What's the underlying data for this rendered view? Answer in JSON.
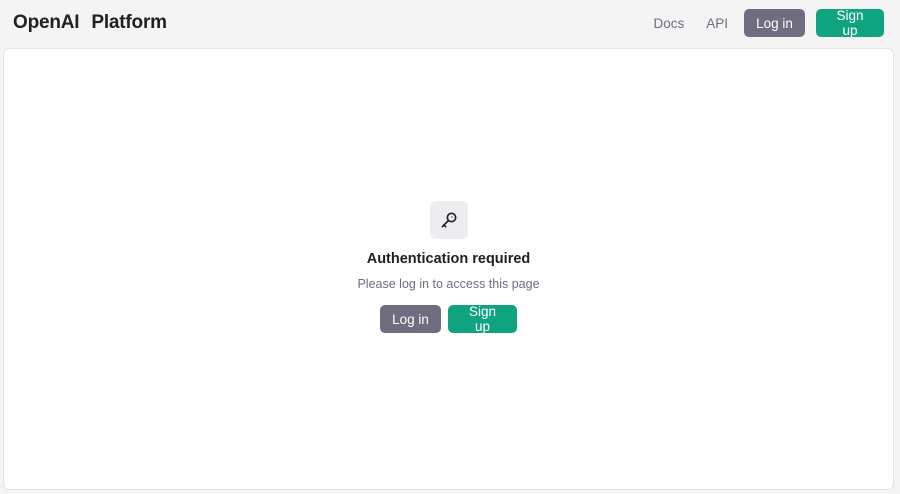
{
  "header": {
    "brand_left": "OpenAI",
    "brand_right": "Platform",
    "nav": {
      "docs": "Docs",
      "api": "API",
      "login": "Log in",
      "signup": "Sign up"
    }
  },
  "main": {
    "icon": "key-icon",
    "title": "Authentication required",
    "subtitle": "Please log in to access this page",
    "login": "Log in",
    "signup": "Sign up"
  },
  "colors": {
    "accent_green": "#10a37f",
    "button_gray": "#6e6e80",
    "page_bg": "#f4f4f4",
    "panel_bg": "#ffffff"
  }
}
